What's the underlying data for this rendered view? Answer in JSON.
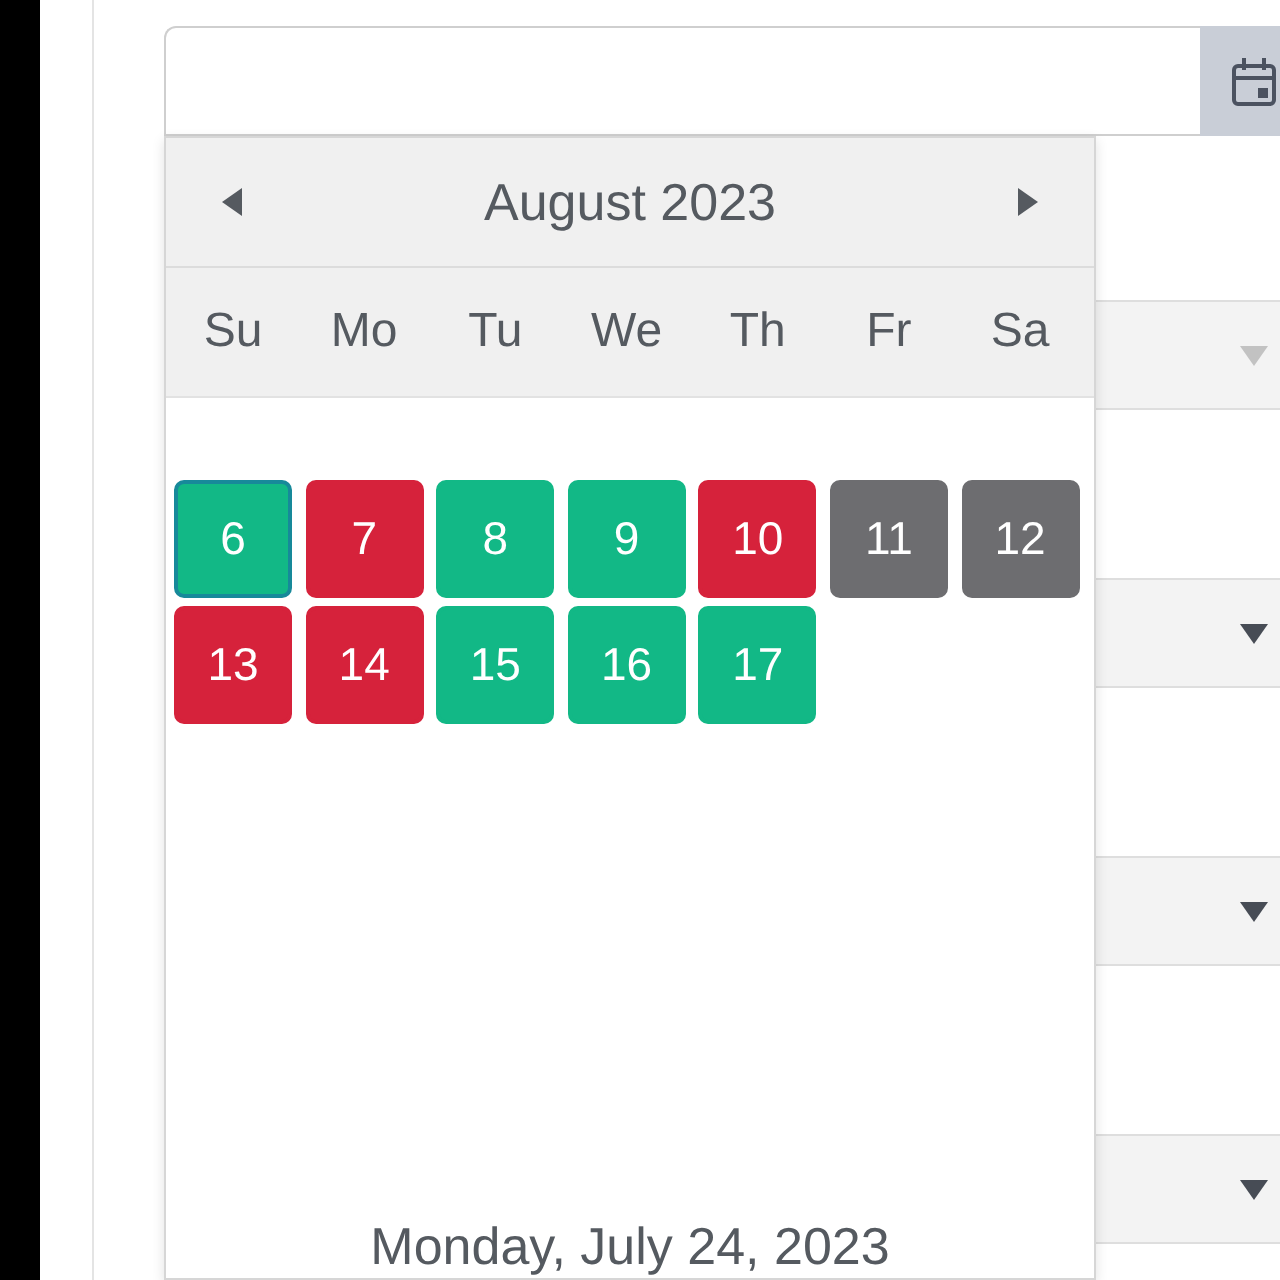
{
  "calendar": {
    "month": "August 2023",
    "weekdays": [
      "Su",
      "Mo",
      "Tu",
      "We",
      "Th",
      "Fr",
      "Sa"
    ],
    "days": [
      {
        "label": "6",
        "color": "#12b886",
        "selected": true
      },
      {
        "label": "7",
        "color": "#d6223b",
        "selected": false
      },
      {
        "label": "8",
        "color": "#12b886",
        "selected": false
      },
      {
        "label": "9",
        "color": "#12b886",
        "selected": false
      },
      {
        "label": "10",
        "color": "#d6223b",
        "selected": false
      },
      {
        "label": "11",
        "color": "#6d6d70",
        "selected": false
      },
      {
        "label": "12",
        "color": "#6d6d70",
        "selected": false
      },
      {
        "label": "13",
        "color": "#d6223b",
        "selected": false
      },
      {
        "label": "14",
        "color": "#d6223b",
        "selected": false
      },
      {
        "label": "15",
        "color": "#12b886",
        "selected": false
      },
      {
        "label": "16",
        "color": "#12b886",
        "selected": false
      },
      {
        "label": "17",
        "color": "#12b886",
        "selected": false
      }
    ],
    "footer": "Monday, July 24, 2023"
  },
  "background_selects": [
    {
      "disabled": true
    },
    {
      "disabled": false
    },
    {
      "disabled": false
    },
    {
      "disabled": false
    }
  ]
}
